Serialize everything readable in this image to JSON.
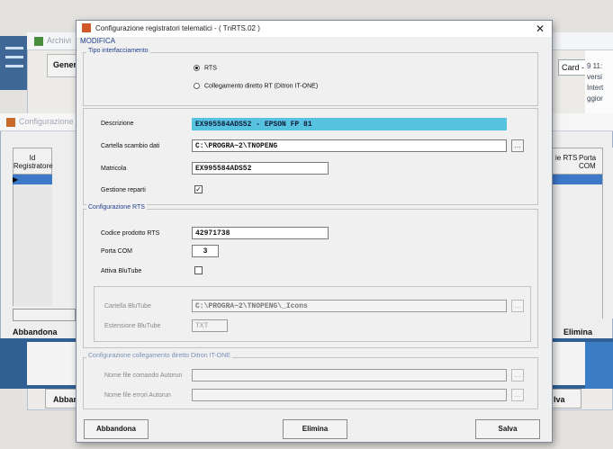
{
  "background": {
    "archive_title": "Archivi",
    "tab_general": "Gener",
    "tab_card": "Card - ı̲",
    "right_strip_lines": [
      "9 11:",
      "versi",
      "Intert",
      "ggior"
    ],
    "config_title": "Configurazione",
    "grid_col_id": "Id Registratore",
    "grid_col_rts": "ie RTS",
    "grid_col_com": "Porta COM",
    "btn_abbandona": "Abbandona",
    "btn_elimina": "Elimina",
    "btn_abbandona_short": "Abban",
    "btn_salva_short": "lva"
  },
  "dialog": {
    "title": "Configurazione registratori telematici - ( TnRTS.02 )",
    "mode": "MODIFICA",
    "group_tipo": {
      "legend": "Tipo interfacciamento",
      "radio_rts": "RTS",
      "radio_ditron": "Collegamento diretto RT (Ditron IT-ONE)",
      "selected": "RTS"
    },
    "fields": {
      "descrizione_label": "Descrizione",
      "descrizione_value": "EX995584ADS52 - EPSON FP 81",
      "cartella_label": "Cartella scambio dati",
      "cartella_value": "C:\\PROGRA~2\\TNOPENG",
      "matricola_label": "Matricola",
      "matricola_value": "EX995584ADS52",
      "gestione_label": "Gestione reparti",
      "gestione_checked": "✓"
    },
    "group_rts": {
      "legend": "Configurazione RTS",
      "codice_label": "Codice prodotto RTS",
      "codice_value": "42971738",
      "porta_label": "Porta COM",
      "porta_value": "3",
      "blutube_label": "Attiva BluTube",
      "cartella_blutube_label": "Cartella BluTube",
      "cartella_blutube_value": "C:\\PROGRA~2\\TNOPENG\\_Icons",
      "estensione_label": "Estensione BluTube",
      "estensione_value": "TXT"
    },
    "group_ditron": {
      "legend": "Configurazione collegamento diretto Ditron IT-ONE",
      "comando_label": "Nome file comando Autorun",
      "errori_label": "Nome file errori Autorun"
    },
    "buttons": {
      "abbandona": "Abbandona",
      "elimina": "Elimina",
      "salva": "Salva"
    },
    "browse_glyph": "…"
  }
}
